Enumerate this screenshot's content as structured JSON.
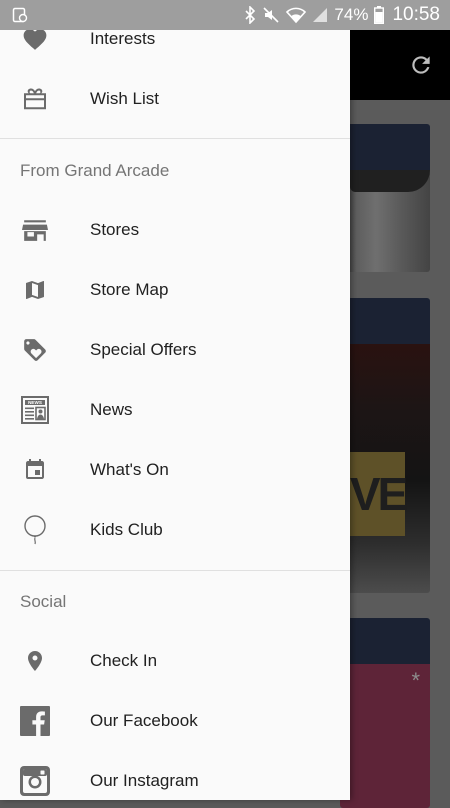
{
  "status_bar": {
    "battery": "74%",
    "time": "10:58"
  },
  "drawer": {
    "top_items": [
      {
        "label": "Interests",
        "icon": "heart-icon"
      },
      {
        "label": "Wish List",
        "icon": "gift-icon"
      }
    ],
    "sections": [
      {
        "title": "From Grand Arcade",
        "items": [
          {
            "label": "Stores",
            "icon": "store-icon"
          },
          {
            "label": "Store Map",
            "icon": "map-icon"
          },
          {
            "label": "Special Offers",
            "icon": "tag-heart-icon"
          },
          {
            "label": "News",
            "icon": "newspaper-icon"
          },
          {
            "label": "What's On",
            "icon": "calendar-icon"
          },
          {
            "label": "Kids Club",
            "icon": "balloon-icon"
          }
        ]
      },
      {
        "title": "Social",
        "items": [
          {
            "label": "Check In",
            "icon": "location-pin-icon"
          },
          {
            "label": "Our Facebook",
            "icon": "facebook-icon"
          },
          {
            "label": "Our Instagram",
            "icon": "instagram-icon"
          }
        ]
      }
    ]
  },
  "background": {
    "card2_sign_text": "VE",
    "card3_mark": "*"
  },
  "colors": {
    "icon_gray": "#6b6b6b",
    "drawer_bg": "#fafafa",
    "section_title": "#757575"
  }
}
